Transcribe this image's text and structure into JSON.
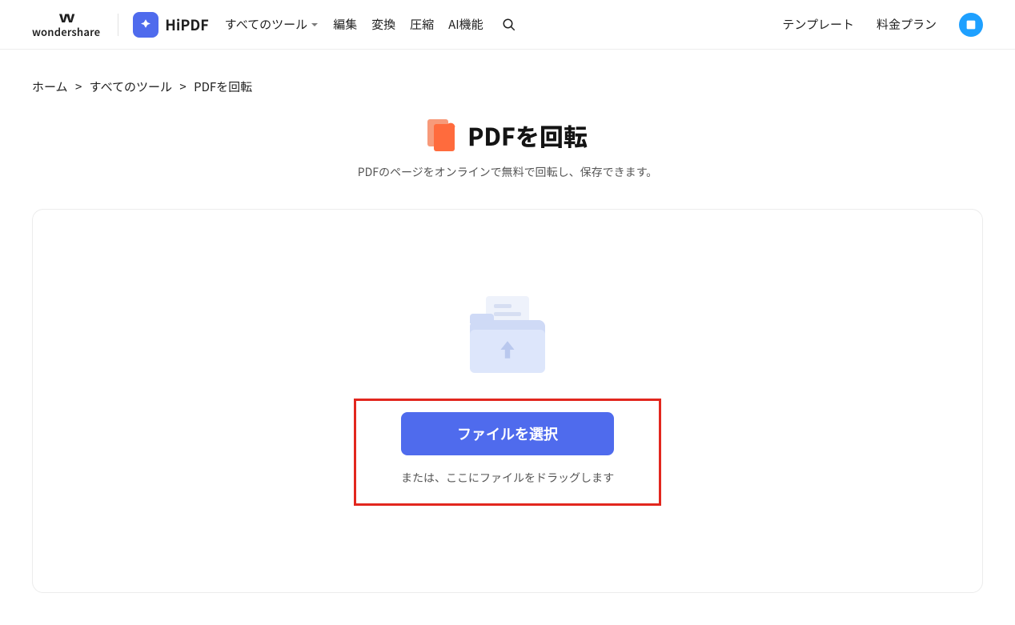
{
  "header": {
    "wondershare_label": "wondershare",
    "hipdf_label": "HiPDF",
    "nav": {
      "all_tools": "すべてのツール",
      "edit": "編集",
      "convert": "変換",
      "compress": "圧縮",
      "ai": "AI機能"
    },
    "right": {
      "templates": "テンプレート",
      "pricing": "料金プラン"
    }
  },
  "breadcrumb": {
    "home": "ホーム",
    "all_tools": "すべてのツール",
    "current": "PDFを回転"
  },
  "page": {
    "title": "PDFを回転",
    "subtitle": "PDFのページをオンラインで無料で回転し、保存できます。"
  },
  "upload": {
    "select_button": "ファイルを選択",
    "drag_text": "または、ここにファイルをドラッグします"
  }
}
